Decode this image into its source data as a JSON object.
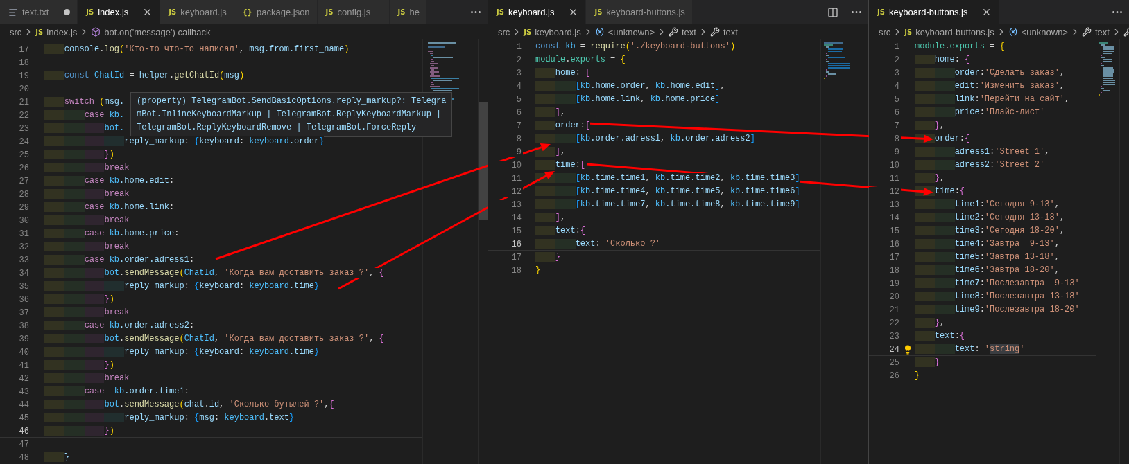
{
  "panes": [
    {
      "tabs": [
        {
          "label": "text.txt",
          "kind": "text",
          "selected": false,
          "modified": true
        },
        {
          "label": "index.js",
          "kind": "js",
          "badge": "JS",
          "selected": true,
          "modified": false
        },
        {
          "label": "keyboard.js",
          "kind": "js",
          "badge": "JS",
          "selected": false,
          "modified": false
        },
        {
          "label": "package.json",
          "kind": "json",
          "badge": "{}",
          "selected": false,
          "modified": false
        },
        {
          "label": "config.js",
          "kind": "js",
          "badge": "JS",
          "selected": false,
          "modified": false
        },
        {
          "label": "he",
          "kind": "js",
          "badge": "JS",
          "selected": false,
          "modified": false
        }
      ],
      "actions": [
        {
          "kind": "more"
        }
      ],
      "breadcrumb": [
        {
          "kind": "folder",
          "label": "src"
        },
        {
          "kind": "file",
          "badge": "JS",
          "label": "index.js"
        },
        {
          "kind": "symbol",
          "label": "bot.on('message') callback"
        }
      ],
      "lines": [
        {
          "number": "17",
          "current": false,
          "tokens": [
            {
              "text": "    console",
              "kind": "var"
            },
            {
              "text": ".",
              "kind": "punc"
            },
            {
              "text": "log",
              "kind": "fn"
            },
            {
              "text": "(",
              "kind": "b1"
            },
            {
              "text": "'Кто-то что-то написал'",
              "kind": "str"
            },
            {
              "text": ", ",
              "kind": "punc"
            },
            {
              "text": "msg.from.first_name",
              "kind": "var"
            },
            {
              "text": ")",
              "kind": "b1"
            }
          ]
        },
        {
          "number": "18",
          "current": false
        },
        {
          "number": "19",
          "current": false,
          "tokens": [
            {
              "text": "    const ",
              "kind": "decl"
            },
            {
              "text": "ChatId",
              "kind": "const"
            },
            {
              "text": " = ",
              "kind": "punc"
            },
            {
              "text": "helper",
              "kind": "var"
            },
            {
              "text": ".",
              "kind": "punc"
            },
            {
              "text": "getChatId",
              "kind": "fn"
            },
            {
              "text": "(",
              "kind": "b1"
            },
            {
              "text": "msg",
              "kind": "var"
            },
            {
              "text": ")",
              "kind": "b1"
            }
          ]
        },
        {
          "number": "20",
          "current": false
        },
        {
          "number": "21",
          "current": false,
          "tokens": [
            {
              "text": "    switch ",
              "kind": "kw"
            },
            {
              "text": "(",
              "kind": "b1"
            },
            {
              "text": "msg.",
              "kind": "var"
            }
          ]
        },
        {
          "number": "22",
          "current": false,
          "tokens": [
            {
              "text": "        case",
              "kind": "kw"
            },
            {
              "text": " kb.",
              "kind": "const"
            }
          ]
        },
        {
          "number": "23",
          "current": false,
          "tokens": [
            {
              "text": "            bot.",
              "kind": "const"
            }
          ]
        },
        {
          "number": "24",
          "current": false,
          "tokens": [
            {
              "text": "                reply_markup",
              "kind": "var"
            },
            {
              "text": ": ",
              "kind": "punc"
            },
            {
              "text": "{",
              "kind": "b3"
            },
            {
              "text": "keyboard",
              "kind": "var"
            },
            {
              "text": ": ",
              "kind": "punc"
            },
            {
              "text": "keyboard",
              "kind": "const"
            },
            {
              "text": ".order",
              "kind": "var"
            },
            {
              "text": "}",
              "kind": "b3"
            }
          ]
        },
        {
          "number": "25",
          "current": false,
          "tokens": [
            {
              "text": "            }",
              "kind": "b2"
            },
            {
              "text": ")",
              "kind": "b1"
            }
          ]
        },
        {
          "number": "26",
          "current": false,
          "tokens": [
            {
              "text": "            break",
              "kind": "kw"
            }
          ]
        },
        {
          "number": "27",
          "current": false,
          "tokens": [
            {
              "text": "        case",
              "kind": "kw"
            },
            {
              "text": " kb",
              "kind": "const"
            },
            {
              "text": ".home.edit",
              "kind": "var"
            },
            {
              "text": ":",
              "kind": "punc"
            }
          ]
        },
        {
          "number": "28",
          "current": false,
          "tokens": [
            {
              "text": "            break",
              "kind": "kw"
            }
          ]
        },
        {
          "number": "29",
          "current": false,
          "tokens": [
            {
              "text": "        case",
              "kind": "kw"
            },
            {
              "text": " kb",
              "kind": "const"
            },
            {
              "text": ".home.link",
              "kind": "var"
            },
            {
              "text": ":",
              "kind": "punc"
            }
          ]
        },
        {
          "number": "30",
          "current": false,
          "tokens": [
            {
              "text": "            break",
              "kind": "kw"
            }
          ]
        },
        {
          "number": "31",
          "current": false,
          "tokens": [
            {
              "text": "        case",
              "kind": "kw"
            },
            {
              "text": " kb",
              "kind": "const"
            },
            {
              "text": ".home.price",
              "kind": "var"
            },
            {
              "text": ":",
              "kind": "punc"
            }
          ]
        },
        {
          "number": "32",
          "current": false,
          "tokens": [
            {
              "text": "            break",
              "kind": "kw"
            }
          ]
        },
        {
          "number": "33",
          "current": false,
          "tokens": [
            {
              "text": "        case",
              "kind": "kw"
            },
            {
              "text": " kb",
              "kind": "const"
            },
            {
              "text": ".order.adress1",
              "kind": "var"
            },
            {
              "text": ":",
              "kind": "punc"
            }
          ]
        },
        {
          "number": "34",
          "current": false,
          "tokens": [
            {
              "text": "            bot",
              "kind": "const"
            },
            {
              "text": ".",
              "kind": "punc"
            },
            {
              "text": "sendMessage",
              "kind": "fn"
            },
            {
              "text": "(",
              "kind": "b1"
            },
            {
              "text": "ChatId",
              "kind": "const"
            },
            {
              "text": ", ",
              "kind": "punc"
            },
            {
              "text": "'Когда вам доставить заказ ?'",
              "kind": "str"
            },
            {
              "text": ", ",
              "kind": "punc"
            },
            {
              "text": "{",
              "kind": "b2"
            }
          ]
        },
        {
          "number": "35",
          "current": false,
          "tokens": [
            {
              "text": "                reply_markup",
              "kind": "var"
            },
            {
              "text": ": ",
              "kind": "punc"
            },
            {
              "text": "{",
              "kind": "b3"
            },
            {
              "text": "keyboard",
              "kind": "var"
            },
            {
              "text": ": ",
              "kind": "punc"
            },
            {
              "text": "keyboard",
              "kind": "const"
            },
            {
              "text": ".time",
              "kind": "var"
            },
            {
              "text": "}",
              "kind": "b3"
            }
          ]
        },
        {
          "number": "36",
          "current": false,
          "tokens": [
            {
              "text": "            }",
              "kind": "b2"
            },
            {
              "text": ")",
              "kind": "b1"
            }
          ]
        },
        {
          "number": "37",
          "current": false,
          "tokens": [
            {
              "text": "            break",
              "kind": "kw"
            }
          ]
        },
        {
          "number": "38",
          "current": false,
          "tokens": [
            {
              "text": "        case",
              "kind": "kw"
            },
            {
              "text": " kb",
              "kind": "const"
            },
            {
              "text": ".order.adress2",
              "kind": "var"
            },
            {
              "text": ":",
              "kind": "punc"
            }
          ]
        },
        {
          "number": "39",
          "current": false,
          "tokens": [
            {
              "text": "            bot",
              "kind": "const"
            },
            {
              "text": ".",
              "kind": "punc"
            },
            {
              "text": "sendMessage",
              "kind": "fn"
            },
            {
              "text": "(",
              "kind": "b1"
            },
            {
              "text": "ChatId",
              "kind": "const"
            },
            {
              "text": ", ",
              "kind": "punc"
            },
            {
              "text": "'Когда вам доставить заказ ?'",
              "kind": "str"
            },
            {
              "text": ", ",
              "kind": "punc"
            },
            {
              "text": "{",
              "kind": "b2"
            }
          ]
        },
        {
          "number": "40",
          "current": false,
          "tokens": [
            {
              "text": "                reply_markup",
              "kind": "var"
            },
            {
              "text": ": ",
              "kind": "punc"
            },
            {
              "text": "{",
              "kind": "b3"
            },
            {
              "text": "keyboard",
              "kind": "var"
            },
            {
              "text": ": ",
              "kind": "punc"
            },
            {
              "text": "keyboard",
              "kind": "const"
            },
            {
              "text": ".time",
              "kind": "var"
            },
            {
              "text": "}",
              "kind": "b3"
            }
          ]
        },
        {
          "number": "41",
          "current": false,
          "tokens": [
            {
              "text": "            }",
              "kind": "b2"
            },
            {
              "text": ")",
              "kind": "b1"
            }
          ]
        },
        {
          "number": "42",
          "current": false,
          "tokens": [
            {
              "text": "            break",
              "kind": "kw"
            }
          ]
        },
        {
          "number": "43",
          "current": false,
          "tokens": [
            {
              "text": "        case",
              "kind": "kw"
            },
            {
              "text": "  kb",
              "kind": "const"
            },
            {
              "text": ".order.time1",
              "kind": "var"
            },
            {
              "text": ":",
              "kind": "punc"
            }
          ]
        },
        {
          "number": "44",
          "current": false,
          "tokens": [
            {
              "text": "            bot",
              "kind": "const"
            },
            {
              "text": ".",
              "kind": "punc"
            },
            {
              "text": "sendMessage",
              "kind": "fn"
            },
            {
              "text": "(",
              "kind": "b1"
            },
            {
              "text": "chat",
              "kind": "var"
            },
            {
              "text": ".",
              "kind": "punc"
            },
            {
              "text": "id",
              "kind": "var"
            },
            {
              "text": ", ",
              "kind": "punc"
            },
            {
              "text": "'Сколько бутылей ?'",
              "kind": "str"
            },
            {
              "text": ",",
              "kind": "punc"
            },
            {
              "text": "{",
              "kind": "b2"
            }
          ]
        },
        {
          "number": "45",
          "current": false,
          "tokens": [
            {
              "text": "                reply_markup",
              "kind": "var"
            },
            {
              "text": ": ",
              "kind": "punc"
            },
            {
              "text": "{",
              "kind": "b3"
            },
            {
              "text": "msg",
              "kind": "var"
            },
            {
              "text": ": ",
              "kind": "punc"
            },
            {
              "text": "keyboard",
              "kind": "const"
            },
            {
              "text": ".",
              "kind": "punc"
            },
            {
              "text": "text",
              "kind": "var"
            },
            {
              "text": "}",
              "kind": "b3"
            }
          ]
        },
        {
          "number": "46",
          "current": true,
          "tokens": [
            {
              "text": "            }",
              "kind": "b2"
            },
            {
              "text": ")",
              "kind": "b1"
            }
          ]
        },
        {
          "number": "47",
          "current": false
        },
        {
          "number": "48",
          "current": false,
          "tokens": [
            {
              "text": "    }",
              "kind": "var"
            }
          ]
        }
      ],
      "tooltip": {
        "text": "(property) TelegramBot.SendBasicOptions.reply_markup?: TelegramBot.InlineKeyboardMarkup | TelegramBot.ReplyKeyboardMarkup | TelegramBot.ReplyKeyboardRemove | TelegramBot.ForceReply"
      }
    },
    {
      "tabs": [
        {
          "label": "keyboard.js",
          "kind": "js",
          "badge": "JS",
          "selected": true,
          "modified": false
        },
        {
          "label": "keyboard-buttons.js",
          "kind": "js",
          "badge": "JS",
          "selected": false,
          "modified": false
        }
      ],
      "actions": [
        {
          "kind": "split"
        },
        {
          "kind": "more"
        }
      ],
      "breadcrumb": [
        {
          "kind": "folder",
          "label": "src"
        },
        {
          "kind": "file",
          "badge": "JS",
          "label": "keyboard.js"
        },
        {
          "kind": "variable",
          "label": "<unknown>"
        },
        {
          "kind": "property",
          "label": "text"
        },
        {
          "kind": "property",
          "label": "text"
        }
      ],
      "lines": [
        {
          "number": "1",
          "current": false,
          "tokens": [
            {
              "text": "const ",
              "kind": "decl"
            },
            {
              "text": "kb",
              "kind": "const"
            },
            {
              "text": " = ",
              "kind": "punc"
            },
            {
              "text": "require",
              "kind": "fn"
            },
            {
              "text": "(",
              "kind": "b1"
            },
            {
              "text": "'./keyboard-buttons'",
              "kind": "str"
            },
            {
              "text": ")",
              "kind": "b1"
            }
          ]
        },
        {
          "number": "2",
          "current": false,
          "tokens": [
            {
              "text": "module",
              "kind": "type"
            },
            {
              "text": ".",
              "kind": "punc"
            },
            {
              "text": "exports",
              "kind": "type"
            },
            {
              "text": " = ",
              "kind": "punc"
            },
            {
              "text": "{",
              "kind": "b1"
            }
          ]
        },
        {
          "number": "3",
          "current": false,
          "tokens": [
            {
              "text": "    home",
              "kind": "var"
            },
            {
              "text": ": ",
              "kind": "punc"
            },
            {
              "text": "[",
              "kind": "b2"
            }
          ]
        },
        {
          "number": "4",
          "current": false,
          "tokens": [
            {
              "text": "        [",
              "kind": "b3"
            },
            {
              "text": "kb",
              "kind": "const"
            },
            {
              "text": ".home.order",
              "kind": "var"
            },
            {
              "text": ", ",
              "kind": "punc"
            },
            {
              "text": "kb",
              "kind": "const"
            },
            {
              "text": ".home.edit",
              "kind": "var"
            },
            {
              "text": "]",
              "kind": "b3"
            },
            {
              "text": ",",
              "kind": "punc"
            }
          ]
        },
        {
          "number": "5",
          "current": false,
          "tokens": [
            {
              "text": "        [",
              "kind": "b3"
            },
            {
              "text": "kb",
              "kind": "const"
            },
            {
              "text": ".home.link",
              "kind": "var"
            },
            {
              "text": ", ",
              "kind": "punc"
            },
            {
              "text": "kb",
              "kind": "const"
            },
            {
              "text": ".home.price",
              "kind": "var"
            },
            {
              "text": "]",
              "kind": "b3"
            }
          ]
        },
        {
          "number": "6",
          "current": false,
          "tokens": [
            {
              "text": "    ]",
              "kind": "b2"
            },
            {
              "text": ",",
              "kind": "punc"
            }
          ]
        },
        {
          "number": "7",
          "current": false,
          "tokens": [
            {
              "text": "    order",
              "kind": "var"
            },
            {
              "text": ":",
              "kind": "punc"
            },
            {
              "text": "[",
              "kind": "b2"
            }
          ]
        },
        {
          "number": "8",
          "current": false,
          "tokens": [
            {
              "text": "        [",
              "kind": "b3"
            },
            {
              "text": "kb",
              "kind": "const"
            },
            {
              "text": ".order.adress1",
              "kind": "var"
            },
            {
              "text": ", ",
              "kind": "punc"
            },
            {
              "text": "kb",
              "kind": "const"
            },
            {
              "text": ".order.adress2",
              "kind": "var"
            },
            {
              "text": "]",
              "kind": "b3"
            }
          ]
        },
        {
          "number": "9",
          "current": false,
          "tokens": [
            {
              "text": "    ]",
              "kind": "b2"
            },
            {
              "text": ",",
              "kind": "punc"
            }
          ]
        },
        {
          "number": "10",
          "current": false,
          "tokens": [
            {
              "text": "    time",
              "kind": "var"
            },
            {
              "text": ":",
              "kind": "punc"
            },
            {
              "text": "[",
              "kind": "b2"
            }
          ]
        },
        {
          "number": "11",
          "current": false,
          "tokens": [
            {
              "text": "        [",
              "kind": "b3"
            },
            {
              "text": "kb",
              "kind": "const"
            },
            {
              "text": ".time.time1",
              "kind": "var"
            },
            {
              "text": ", ",
              "kind": "punc"
            },
            {
              "text": "kb",
              "kind": "const"
            },
            {
              "text": ".time.time2",
              "kind": "var"
            },
            {
              "text": ", ",
              "kind": "punc"
            },
            {
              "text": "kb",
              "kind": "const"
            },
            {
              "text": ".time.time3",
              "kind": "var"
            },
            {
              "text": "]",
              "kind": "b3"
            }
          ]
        },
        {
          "number": "12",
          "current": false,
          "tokens": [
            {
              "text": "        [",
              "kind": "b3"
            },
            {
              "text": "kb",
              "kind": "const"
            },
            {
              "text": ".time.time4",
              "kind": "var"
            },
            {
              "text": ", ",
              "kind": "punc"
            },
            {
              "text": "kb",
              "kind": "const"
            },
            {
              "text": ".time.time5",
              "kind": "var"
            },
            {
              "text": ", ",
              "kind": "punc"
            },
            {
              "text": "kb",
              "kind": "const"
            },
            {
              "text": ".time.time6",
              "kind": "var"
            },
            {
              "text": "]",
              "kind": "b3"
            }
          ]
        },
        {
          "number": "13",
          "current": false,
          "tokens": [
            {
              "text": "        [",
              "kind": "b3"
            },
            {
              "text": "kb",
              "kind": "const"
            },
            {
              "text": ".time.time7",
              "kind": "var"
            },
            {
              "text": ", ",
              "kind": "punc"
            },
            {
              "text": "kb",
              "kind": "const"
            },
            {
              "text": ".time.time8",
              "kind": "var"
            },
            {
              "text": ", ",
              "kind": "punc"
            },
            {
              "text": "kb",
              "kind": "const"
            },
            {
              "text": ".time.time9",
              "kind": "var"
            },
            {
              "text": "]",
              "kind": "b3"
            }
          ]
        },
        {
          "number": "14",
          "current": false,
          "tokens": [
            {
              "text": "    ]",
              "kind": "b2"
            },
            {
              "text": ",",
              "kind": "punc"
            }
          ]
        },
        {
          "number": "15",
          "current": false,
          "tokens": [
            {
              "text": "    text",
              "kind": "var"
            },
            {
              "text": ":",
              "kind": "punc"
            },
            {
              "text": "{",
              "kind": "b2"
            }
          ]
        },
        {
          "number": "16",
          "current": true,
          "tokens": [
            {
              "text": "        text",
              "kind": "var"
            },
            {
              "text": ": ",
              "kind": "punc"
            },
            {
              "text": "'Сколько ?'",
              "kind": "str"
            }
          ]
        },
        {
          "number": "17",
          "current": false,
          "tokens": [
            {
              "text": "    }",
              "kind": "b2"
            }
          ]
        },
        {
          "number": "18",
          "current": false,
          "tokens": [
            {
              "text": "}",
              "kind": "b1"
            }
          ]
        }
      ]
    },
    {
      "tabs": [
        {
          "label": "keyboard-buttons.js",
          "kind": "js",
          "badge": "JS",
          "selected": true,
          "modified": false
        }
      ],
      "actions": [
        {
          "kind": "more"
        }
      ],
      "breadcrumb": [
        {
          "kind": "folder",
          "label": "src"
        },
        {
          "kind": "file",
          "badge": "JS",
          "label": "keyboard-buttons.js"
        },
        {
          "kind": "variable",
          "label": "<unknown>"
        },
        {
          "kind": "property",
          "label": "text"
        },
        {
          "kind": "property"
        }
      ],
      "lines": [
        {
          "number": "1",
          "current": false,
          "tokens": [
            {
              "text": "module",
              "kind": "type"
            },
            {
              "text": ".",
              "kind": "punc"
            },
            {
              "text": "exports",
              "kind": "type"
            },
            {
              "text": " = ",
              "kind": "punc"
            },
            {
              "text": "{",
              "kind": "b1"
            }
          ]
        },
        {
          "number": "2",
          "current": false,
          "tokens": [
            {
              "text": "    home",
              "kind": "var"
            },
            {
              "text": ": ",
              "kind": "punc"
            },
            {
              "text": "{",
              "kind": "b2"
            }
          ]
        },
        {
          "number": "3",
          "current": false,
          "tokens": [
            {
              "text": "        order",
              "kind": "var"
            },
            {
              "text": ":",
              "kind": "punc"
            },
            {
              "text": "'Сделать заказ'",
              "kind": "str"
            },
            {
              "text": ",",
              "kind": "punc"
            }
          ]
        },
        {
          "number": "4",
          "current": false,
          "tokens": [
            {
              "text": "        edit",
              "kind": "var"
            },
            {
              "text": ":",
              "kind": "punc"
            },
            {
              "text": "'Изменить заказ'",
              "kind": "str"
            },
            {
              "text": ",",
              "kind": "punc"
            }
          ]
        },
        {
          "number": "5",
          "current": false,
          "tokens": [
            {
              "text": "        link",
              "kind": "var"
            },
            {
              "text": ":",
              "kind": "punc"
            },
            {
              "text": "'Перейти на сайт'",
              "kind": "str"
            },
            {
              "text": ",",
              "kind": "punc"
            }
          ]
        },
        {
          "number": "6",
          "current": false,
          "tokens": [
            {
              "text": "        price",
              "kind": "var"
            },
            {
              "text": ":",
              "kind": "punc"
            },
            {
              "text": "'Плайс-лист'",
              "kind": "str"
            }
          ]
        },
        {
          "number": "7",
          "current": false,
          "tokens": [
            {
              "text": "    }",
              "kind": "b2"
            },
            {
              "text": ",",
              "kind": "punc"
            }
          ]
        },
        {
          "number": "8",
          "current": false,
          "tokens": [
            {
              "text": "    order",
              "kind": "var"
            },
            {
              "text": ":",
              "kind": "punc"
            },
            {
              "text": "{",
              "kind": "b2"
            }
          ]
        },
        {
          "number": "9",
          "current": false,
          "tokens": [
            {
              "text": "        adress1",
              "kind": "var"
            },
            {
              "text": ":",
              "kind": "punc"
            },
            {
              "text": "'Street 1'",
              "kind": "str"
            },
            {
              "text": ",",
              "kind": "punc"
            }
          ]
        },
        {
          "number": "10",
          "current": false,
          "tokens": [
            {
              "text": "        adress2",
              "kind": "var"
            },
            {
              "text": ":",
              "kind": "punc"
            },
            {
              "text": "'Street 2'",
              "kind": "str"
            }
          ]
        },
        {
          "number": "11",
          "current": false,
          "tokens": [
            {
              "text": "    }",
              "kind": "b2"
            },
            {
              "text": ",",
              "kind": "punc"
            }
          ]
        },
        {
          "number": "12",
          "current": false,
          "tokens": [
            {
              "text": "    time",
              "kind": "var"
            },
            {
              "text": ":",
              "kind": "punc"
            },
            {
              "text": "{",
              "kind": "b2"
            }
          ]
        },
        {
          "number": "13",
          "current": false,
          "tokens": [
            {
              "text": "        time1",
              "kind": "var"
            },
            {
              "text": ":",
              "kind": "punc"
            },
            {
              "text": "'Сегодня 9-13'",
              "kind": "str"
            },
            {
              "text": ",",
              "kind": "punc"
            }
          ]
        },
        {
          "number": "14",
          "current": false,
          "tokens": [
            {
              "text": "        time2",
              "kind": "var"
            },
            {
              "text": ":",
              "kind": "punc"
            },
            {
              "text": "'Сегодня 13-18'",
              "kind": "str"
            },
            {
              "text": ",",
              "kind": "punc"
            }
          ]
        },
        {
          "number": "15",
          "current": false,
          "tokens": [
            {
              "text": "        time3",
              "kind": "var"
            },
            {
              "text": ":",
              "kind": "punc"
            },
            {
              "text": "'Сегодня 18-20'",
              "kind": "str"
            },
            {
              "text": ",",
              "kind": "punc"
            }
          ]
        },
        {
          "number": "16",
          "current": false,
          "tokens": [
            {
              "text": "        time4",
              "kind": "var"
            },
            {
              "text": ":",
              "kind": "punc"
            },
            {
              "text": "'Завтра  9-13'",
              "kind": "str"
            },
            {
              "text": ",",
              "kind": "punc"
            }
          ]
        },
        {
          "number": "17",
          "current": false,
          "tokens": [
            {
              "text": "        time5",
              "kind": "var"
            },
            {
              "text": ":",
              "kind": "punc"
            },
            {
              "text": "'Завтра 13-18'",
              "kind": "str"
            },
            {
              "text": ",",
              "kind": "punc"
            }
          ]
        },
        {
          "number": "18",
          "current": false,
          "tokens": [
            {
              "text": "        time6",
              "kind": "var"
            },
            {
              "text": ":",
              "kind": "punc"
            },
            {
              "text": "'Завтра 18-20'",
              "kind": "str"
            },
            {
              "text": ",",
              "kind": "punc"
            }
          ]
        },
        {
          "number": "19",
          "current": false,
          "tokens": [
            {
              "text": "        time7",
              "kind": "var"
            },
            {
              "text": ":",
              "kind": "punc"
            },
            {
              "text": "'Послезавтра  9-13'",
              "kind": "str"
            }
          ]
        },
        {
          "number": "20",
          "current": false,
          "tokens": [
            {
              "text": "        time8",
              "kind": "var"
            },
            {
              "text": ":",
              "kind": "punc"
            },
            {
              "text": "'Послезавтра 13-18'",
              "kind": "str"
            }
          ]
        },
        {
          "number": "21",
          "current": false,
          "tokens": [
            {
              "text": "        time9",
              "kind": "var"
            },
            {
              "text": ":",
              "kind": "punc"
            },
            {
              "text": "'Послезавтра 18-20'",
              "kind": "str"
            }
          ]
        },
        {
          "number": "22",
          "current": false,
          "tokens": [
            {
              "text": "    }",
              "kind": "b2"
            },
            {
              "text": ",",
              "kind": "punc"
            }
          ]
        },
        {
          "number": "23",
          "current": false,
          "tokens": [
            {
              "text": "    text",
              "kind": "var"
            },
            {
              "text": ":",
              "kind": "punc"
            },
            {
              "text": "{",
              "kind": "b2"
            }
          ]
        },
        {
          "number": "24",
          "current": true,
          "lightbulb": true,
          "tokens": [
            {
              "text": "        text",
              "kind": "var"
            },
            {
              "text": ": ",
              "kind": "punc"
            },
            {
              "text": "'",
              "kind": "str"
            },
            {
              "text": "string",
              "kind": "strsel"
            },
            {
              "text": "'",
              "kind": "str"
            }
          ]
        },
        {
          "number": "25",
          "current": false,
          "tokens": [
            {
              "text": "    }",
              "kind": "b2"
            }
          ]
        },
        {
          "number": "26",
          "current": false,
          "tokens": [
            {
              "text": "}",
              "kind": "b1"
            }
          ]
        }
      ]
    }
  ]
}
